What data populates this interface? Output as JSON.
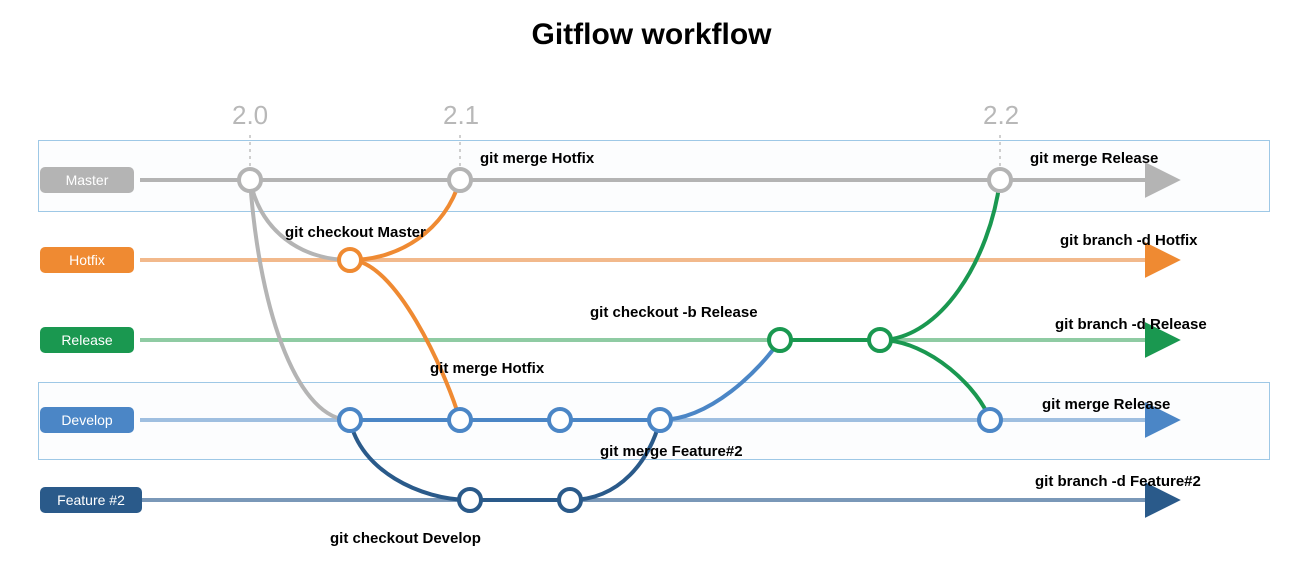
{
  "title": "Gitflow workflow",
  "versions": {
    "v1": "2.0",
    "v2": "2.1",
    "v3": "2.2"
  },
  "branches": {
    "master": {
      "label": "Master",
      "color": "#b4b4b4"
    },
    "hotfix": {
      "label": "Hotfix",
      "color": "#ef8a32"
    },
    "release": {
      "label": "Release",
      "color": "#1a9850"
    },
    "develop": {
      "label": "Develop",
      "color": "#4b86c6"
    },
    "feature2": {
      "label": "Feature #2",
      "color": "#2a5a8a"
    }
  },
  "notes": {
    "checkout_master": "git checkout Master",
    "merge_hotfix_m": "git merge Hotfix",
    "merge_hotfix_d": "git merge Hotfix",
    "checkout_release": "git checkout -b Release",
    "merge_release_m": "git merge Release",
    "merge_release_d": "git merge Release",
    "merge_feature2": "git merge Feature#2",
    "checkout_develop": "git checkout Develop",
    "del_hotfix": "git branch -d Hotfix",
    "del_release": "git branch -d Release",
    "del_feature2": "git branch -d Feature#2"
  },
  "layout": {
    "lanes": {
      "master": 180,
      "hotfix": 260,
      "release": 340,
      "develop": 420,
      "feature2": 500
    },
    "x": {
      "start": 140,
      "end": 1170,
      "v1": 250,
      "v2": 460,
      "v3": 1000,
      "hotfix_node": 350,
      "dev_n1": 350,
      "dev_n2": 460,
      "dev_n3": 560,
      "dev_n4": 660,
      "dev_n5": 990,
      "feat_n1": 470,
      "feat_n2": 570,
      "rel_n1": 780,
      "rel_n2": 880
    }
  }
}
